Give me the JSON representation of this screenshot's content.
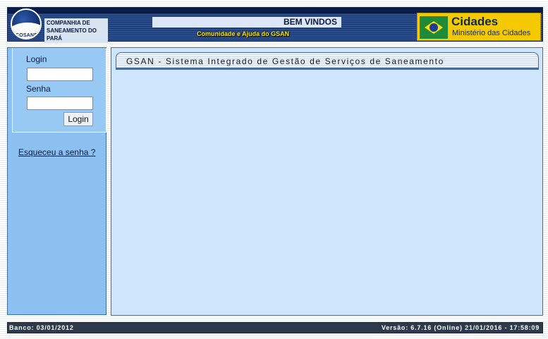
{
  "header": {
    "logo": {
      "abbr": "COSANPA",
      "name_line1": "COMPANHIA DE",
      "name_line2": "SANEAMENTO DO PARÁ"
    },
    "welcome": "BEM VINDOS",
    "help_link": "Comunidade e Ajuda do GSAN",
    "ministry": {
      "title": "Cidades",
      "subtitle": "Ministério das Cidades",
      "icon": "brazil-flag-icon"
    }
  },
  "login": {
    "login_label": "Login",
    "login_value": "",
    "password_label": "Senha",
    "password_value": "",
    "submit_label": "Login",
    "forgot_link": "Esqueceu a senha ?"
  },
  "main": {
    "title": "GSAN - Sistema Integrado de Gestão de Serviços de Saneamento"
  },
  "footer": {
    "left": "Banco: 03/01/2012",
    "right": "Versão: 6.7.16 (Online) 21/01/2016 - 17:58:09"
  },
  "colors": {
    "header_bg": "#1f3e7a",
    "panel_bg": "#8cc0f0",
    "main_bg": "#cfe5fb",
    "footer_bg": "#2c3a4c",
    "ministry_bg": "#f4c900"
  }
}
